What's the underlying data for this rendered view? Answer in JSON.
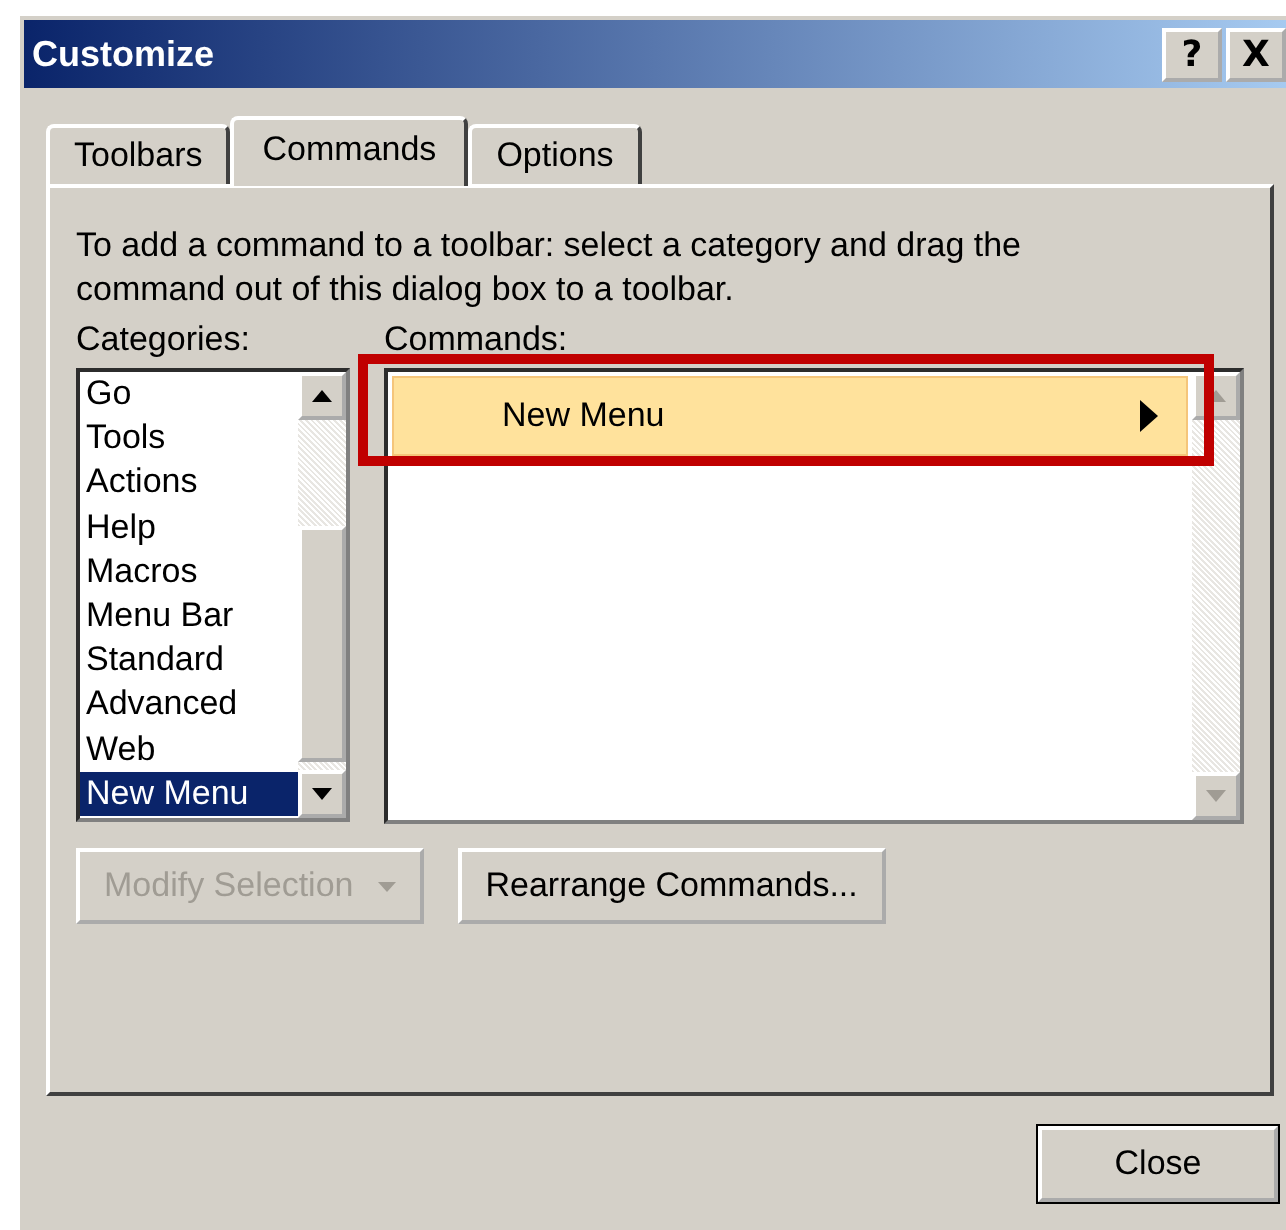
{
  "window": {
    "title": "Customize",
    "title_buttons": [
      "?",
      "X"
    ]
  },
  "tabs": [
    {
      "label": "Toolbars",
      "selected": false
    },
    {
      "label": "Commands",
      "selected": true
    },
    {
      "label": "Options",
      "selected": false
    }
  ],
  "description": "To add a command to a toolbar: select a category and drag the command out of this dialog box to a toolbar.",
  "categories": {
    "label": "Categories:",
    "items": [
      {
        "label": "Go",
        "selected": false
      },
      {
        "label": "Tools",
        "selected": false
      },
      {
        "label": "Actions",
        "selected": false
      },
      {
        "label": "Help",
        "selected": false
      },
      {
        "label": "Macros",
        "selected": false
      },
      {
        "label": "Menu Bar",
        "selected": false
      },
      {
        "label": "Standard",
        "selected": false
      },
      {
        "label": "Advanced",
        "selected": false
      },
      {
        "label": "Web",
        "selected": false
      },
      {
        "label": "New Menu",
        "selected": true
      }
    ]
  },
  "commands": {
    "label": "Commands:",
    "items": [
      {
        "label": "New Menu",
        "highlighted": true,
        "submenu": true
      }
    ]
  },
  "buttons": [
    {
      "label": "Modify Selection",
      "disabled": true,
      "dropdown": true
    },
    {
      "label": "Rearrange Commands...",
      "disabled": false,
      "dropdown": false
    }
  ],
  "footer_buttons": [
    {
      "label": "Close",
      "default": true
    }
  ]
}
